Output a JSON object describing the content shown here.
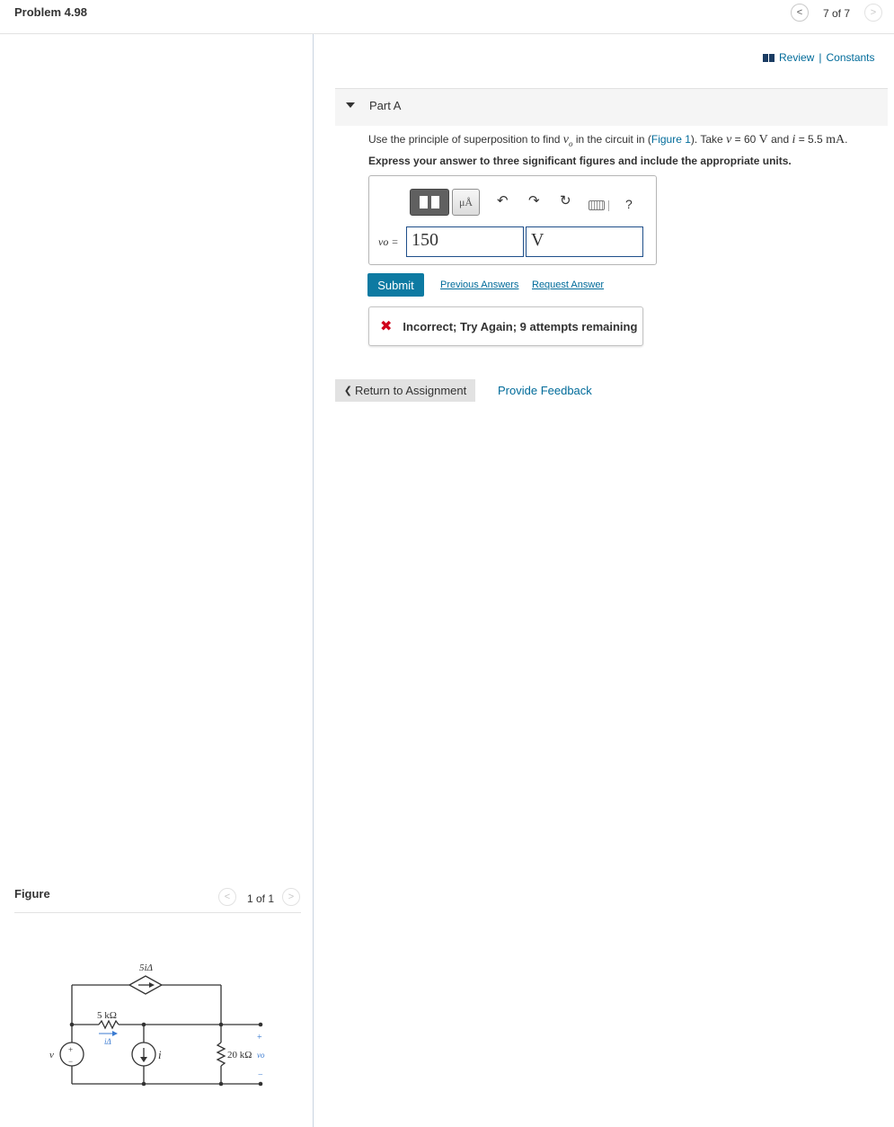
{
  "header": {
    "problem_title": "Problem 4.98",
    "page_counter": "7 of 7",
    "prev_glyph": "<",
    "next_glyph": ">"
  },
  "links": {
    "review": "Review",
    "separator": "|",
    "constants": "Constants"
  },
  "part": {
    "label": "Part A",
    "question_pre": "Use the principle of superposition to find ",
    "question_var": "vo",
    "question_mid": " in the circuit in (",
    "figure_link": "Figure 1",
    "question_post": "). Take ",
    "v_sym": "v",
    "v_val": " = 60 ",
    "v_unit": "V",
    "and": " and ",
    "i_sym": "i",
    "i_val": " = 5.5 ",
    "i_unit": "mA",
    "period": ".",
    "instruction": "Express your answer to three significant figures and include the appropriate units."
  },
  "toolbar": {
    "units_label": "μÅ",
    "undo_glyph": "↶",
    "redo_glyph": "↷",
    "reset_glyph": "↻",
    "help_glyph": "?"
  },
  "answer": {
    "var_label": "vo =",
    "value": "150",
    "unit": "V"
  },
  "actions": {
    "submit": "Submit",
    "previous_answers": "Previous Answers",
    "request_answer": "Request Answer"
  },
  "feedback": {
    "icon": "✖",
    "text": "Incorrect; Try Again; 9 attempts remaining"
  },
  "footer": {
    "return_glyph": "❮",
    "return_label": "Return to Assignment",
    "provide_feedback": "Provide Feedback"
  },
  "figure": {
    "label": "Figure",
    "counter": "1 of 1",
    "prev_glyph": "<",
    "next_glyph": ">",
    "circuit": {
      "dependent_source": "5iΔ",
      "resistor1": "5 kΩ",
      "current_label": "iΔ",
      "source_v": "v",
      "current_source": "i",
      "resistor2": "20 kΩ",
      "output": "vo",
      "plus": "+",
      "minus": "−"
    }
  },
  "colors": {
    "link": "#006b9a",
    "submit": "#0d7aa2",
    "error": "#d0021b"
  }
}
